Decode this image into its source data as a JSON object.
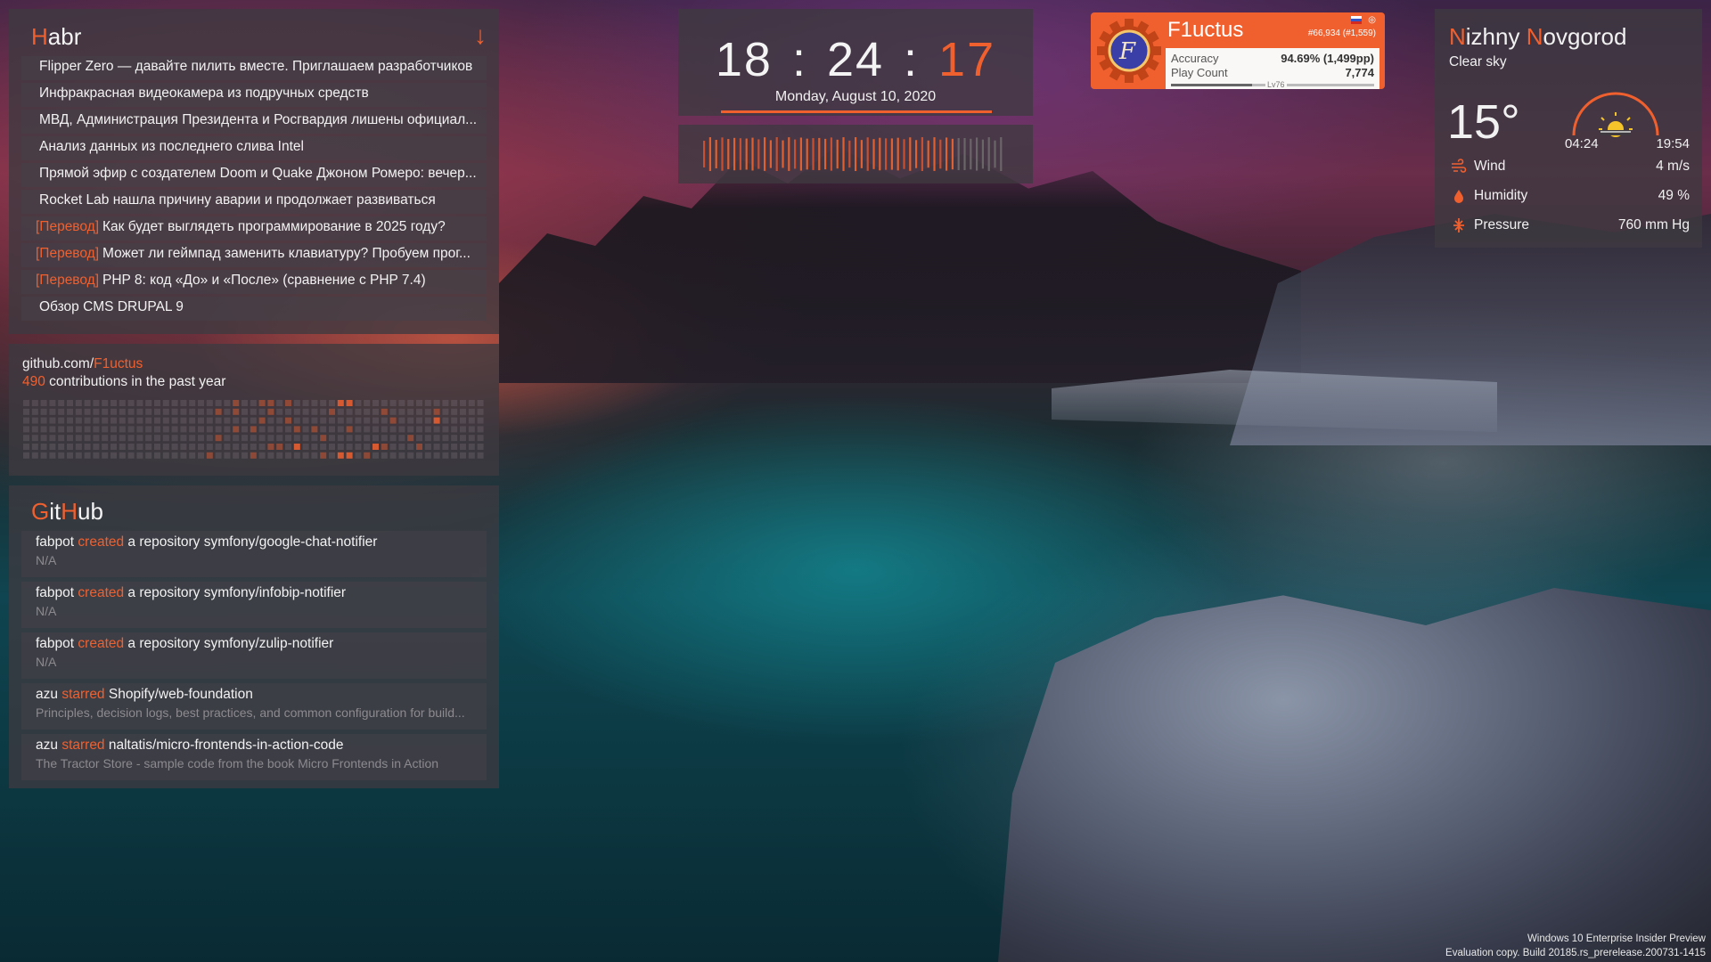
{
  "habr": {
    "title_first": "H",
    "title_rest": "abr",
    "arrow": "↓",
    "items": [
      {
        "tag": "",
        "text": "Flipper Zero — давайте пилить вместе. Приглашаем разработчиков"
      },
      {
        "tag": "",
        "text": "Инфракрасная видеокамера из подручных средств"
      },
      {
        "tag": "",
        "text": "МВД, Администрация Президента и Росгвардия лишены официал..."
      },
      {
        "tag": "",
        "text": "Анализ данных из последнего слива Intel"
      },
      {
        "tag": "",
        "text": "Прямой эфир с создателем Doom и Quake Джоном Ромеро: вечер..."
      },
      {
        "tag": "",
        "text": "Rocket Lab нашла причину аварии и продолжает развиваться"
      },
      {
        "tag": "[Перевод]",
        "text": "Как будет выглядеть программирование в 2025 году?"
      },
      {
        "tag": "[Перевод]",
        "text": "Может ли геймпад заменить клавиатуру? Пробуем прог..."
      },
      {
        "tag": "[Перевод]",
        "text": "PHP 8: код «До» и «После» (сравнение с PHP 7.4)"
      },
      {
        "tag": "",
        "text": "Обзор CMS DRUPAL 9"
      }
    ]
  },
  "github_contrib": {
    "url_prefix": "github.com/",
    "username": "F1uctus",
    "count": "490",
    "count_suffix": " contributions in the past year"
  },
  "github_feed": {
    "title_G": "G",
    "title_it": "it",
    "title_H": "H",
    "title_ub": "ub",
    "items": [
      {
        "actor": "fabpot",
        "verb": "created",
        "object": " a repository symfony/google-chat-notifier",
        "desc": "N/A"
      },
      {
        "actor": "fabpot",
        "verb": "created",
        "object": " a repository symfony/infobip-notifier",
        "desc": "N/A"
      },
      {
        "actor": "fabpot",
        "verb": "created",
        "object": " a repository symfony/zulip-notifier",
        "desc": "N/A"
      },
      {
        "actor": "azu",
        "verb": "starred",
        "object": " Shopify/web-foundation",
        "desc": "Principles, decision logs, best practices, and common configuration for build..."
      },
      {
        "actor": "azu",
        "verb": "starred",
        "object": " naltatis/micro-frontends-in-action-code",
        "desc": "The Tractor Store - sample code from the book Micro Frontends in Action"
      }
    ]
  },
  "clock": {
    "hours": "18",
    "minutes": "24",
    "seconds": "17",
    "separator": ":",
    "date": "Monday, August 10, 2020"
  },
  "osu": {
    "name": "F1uctus",
    "rank": "#66,934 (#1,559)",
    "globe": "◎",
    "accuracy_label": "Accuracy",
    "accuracy_value": "94.69% (1,499pp)",
    "playcount_label": "Play Count",
    "playcount_value": "7,774",
    "level": "Lv76",
    "level_progress": 0.4
  },
  "weather": {
    "city_first": "N",
    "city_rest": "izhny ",
    "city_first2": "N",
    "city_rest2": "ovgorod",
    "condition": "Clear sky",
    "temperature": "15°",
    "sunrise": "04:24",
    "sunset": "19:54",
    "rows": [
      {
        "label": "Wind",
        "value": "4 m/s"
      },
      {
        "label": "Humidity",
        "value": "49 %"
      },
      {
        "label": "Pressure",
        "value": "760 mm Hg"
      }
    ]
  },
  "watermark": {
    "line1": "Windows 10 Enterprise Insider Preview",
    "line2": "Evaluation copy. Build 20185.rs_prerelease.200731-1415"
  },
  "colors": {
    "accent": "#f0602f",
    "panel": "#3e3a40"
  }
}
